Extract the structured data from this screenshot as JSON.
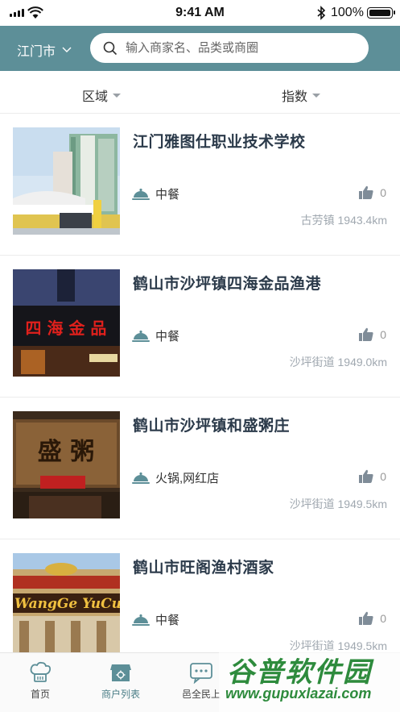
{
  "status_bar": {
    "time": "9:41 AM",
    "battery": "100%"
  },
  "header": {
    "city": "江门市",
    "search_placeholder": "输入商家名、品类或商圈"
  },
  "filters": {
    "area_label": "区域",
    "index_label": "指数"
  },
  "merchants": [
    {
      "name": "江门雅图仕职业技术学校",
      "category": "中餐",
      "likes": "0",
      "distance": "古劳镇 1943.4km"
    },
    {
      "name": "鹤山市沙坪镇四海金品渔港",
      "category": "中餐",
      "likes": "0",
      "distance": "沙坪街道 1949.0km"
    },
    {
      "name": "鹤山市沙坪镇和盛粥庄",
      "category": "火锅,网红店",
      "likes": "0",
      "distance": "沙坪街道 1949.5km"
    },
    {
      "name": "鹤山市旺阁渔村酒家",
      "category": "中餐",
      "likes": "0",
      "distance": "沙坪街道 1949.5km"
    }
  ],
  "thumb_text": {
    "sign_2": "四 海 金 品",
    "sign_3": "盛  粥",
    "sign_4": "WangGe YuCun"
  },
  "tabs": [
    {
      "label": "首页"
    },
    {
      "label": "商户列表"
    },
    {
      "label": "邑全民上"
    }
  ],
  "watermark": {
    "title": "谷普软件园",
    "url": "www.gupuxlazai.com"
  },
  "colors": {
    "brand": "#5d8f98",
    "active_tab": "#4a7d86"
  }
}
